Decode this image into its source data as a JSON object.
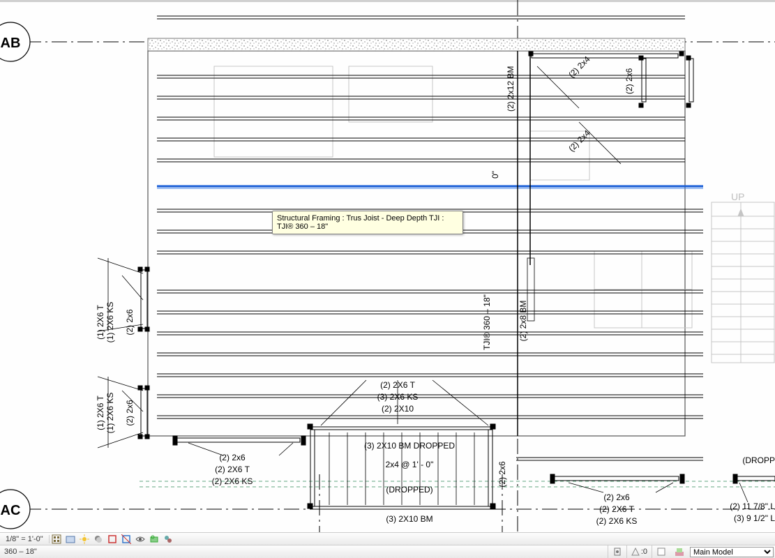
{
  "viewbar": {
    "scale": "1/8\" = 1'-0\""
  },
  "statusbar": {
    "message": "360 – 18\"",
    "constraint": ":0",
    "workset_select": "Main Model"
  },
  "tooltip": {
    "text": "Structural Framing : Trus Joist - Deep Depth TJI : TJI® 360 – 18\""
  },
  "grid_marks": {
    "ab": "AB",
    "ac": "AC"
  },
  "drawing_labels": {
    "up": "UP",
    "left_tag_a_line1": "(1) 2X6 T",
    "left_tag_a_line2": "(1) 2X6 KS",
    "left_tag_a_line3": "(2) 2x6",
    "left_tag_b_line1": "(1) 2X6 T",
    "left_tag_b_line2": "(1) 2X6 KS",
    "left_tag_b_line3": "(2) 2x6",
    "center_tag_line1": "(2) 2X6 T",
    "center_tag_line2": "(3) 2X6 KS",
    "center_tag_line3": "(2) 2X10",
    "bottom_left_line1": "(2) 2x6",
    "bottom_left_line2": "(2) 2X6 T",
    "bottom_left_line3": "(2) 2X6 KS",
    "dropped_bm": "(3)  2X10 BM DROPPED",
    "spacing": "2x4 @ 1' - 0\"",
    "dropped_note": "(DROPPED)",
    "bottom_bm": "(3)  2X10 BM",
    "right_tag_line1": "(2) 2x6",
    "right_tag_line2": "(2) 2X6 T",
    "right_tag_line3": "(2) 2X6 KS",
    "far_right_line1": "(2) 11 7/8\" L",
    "far_right_line2": "(3) 9 1/2\" L",
    "far_right_drop": "(DROPP",
    "v_2x12bm": "(2) 2x12 BM",
    "v_2x4_a": "(2) 2x4",
    "v_2x6": "(2) 2x6",
    "v_2x4_b": "(2) 2x4",
    "v_tji": "TJI® 360 – 18\"",
    "v_0in": "0\"",
    "v_2x8bm": "(2) 2x8 BM",
    "v_2x6_small": "(2) 2x6"
  }
}
